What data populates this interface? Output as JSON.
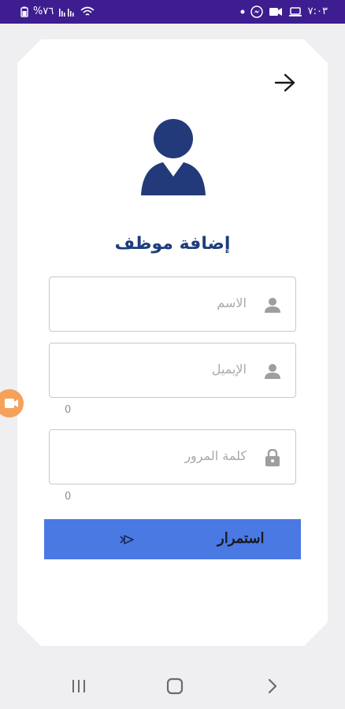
{
  "status_bar": {
    "time": "٧:٠٣",
    "battery": "%٧٦"
  },
  "screen": {
    "title": "إضافة موظف"
  },
  "form": {
    "name_placeholder": "الاسم",
    "email_placeholder": "الإيميل",
    "email_counter": "0",
    "password_placeholder": "كلمة المرور",
    "password_counter": "0",
    "continue_label": "استمرار"
  },
  "colors": {
    "status_bar_bg": "#3d1d8f",
    "accent_button": "#4a79e4",
    "title_color": "#1d3d7c",
    "avatar_color": "#233a7a",
    "record_bubble": "#f5a15a"
  },
  "icons": {
    "back": "arrow-right-icon",
    "avatar": "employee-avatar-icon",
    "name_field": "person-icon",
    "email_field": "person-icon",
    "password_field": "lock-icon",
    "continue": "next-arrow-icon"
  }
}
